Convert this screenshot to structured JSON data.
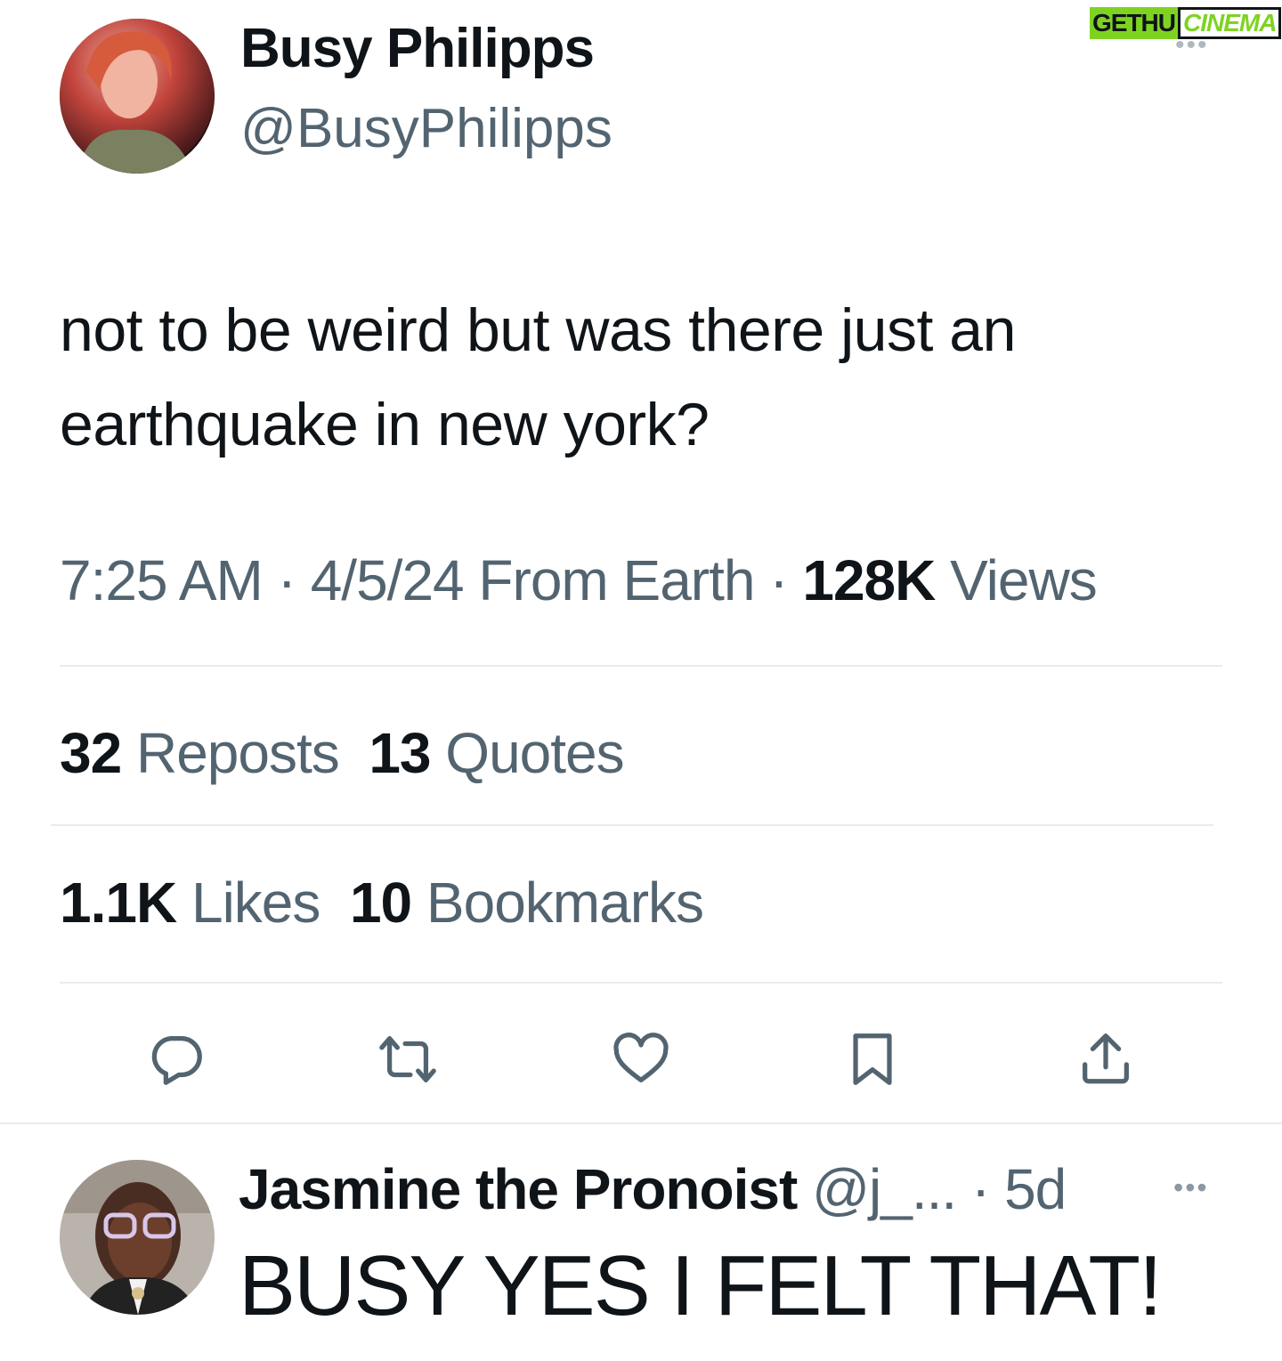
{
  "watermark": {
    "part1": "GETHU",
    "part2": "CINEMA"
  },
  "tweet": {
    "author": {
      "name": "Busy Philipps",
      "handle": "@BusyPhilipps"
    },
    "more": "•••",
    "text": "not to be weird but was there just an earthquake in new york?",
    "meta": {
      "time": "7:25 AM",
      "sep1": " · ",
      "date": "4/5/24",
      "source": " From Earth",
      "sep2": " · ",
      "views_count": "128K",
      "views_label": " Views"
    },
    "stats": {
      "reposts_count": "32",
      "reposts_label": " Reposts",
      "quotes_count": "13",
      "quotes_label": " Quotes",
      "likes_count": "1.1K",
      "likes_label": " Likes",
      "bookmarks_count": "10",
      "bookmarks_label": " Bookmarks"
    }
  },
  "reply": {
    "name": "Jasmine the Pronoist",
    "handle": " @j_...",
    "sep": " · ",
    "age": "5d",
    "more": "•••",
    "text": "BUSY YES I FELT THAT!"
  },
  "colors": {
    "text_primary": "#0f1419",
    "text_secondary": "#536471",
    "divider": "#e6ecf0",
    "watermark_green": "#7ed321"
  },
  "icons": [
    "reply-icon",
    "repost-icon",
    "like-icon",
    "bookmark-icon",
    "share-icon"
  ]
}
